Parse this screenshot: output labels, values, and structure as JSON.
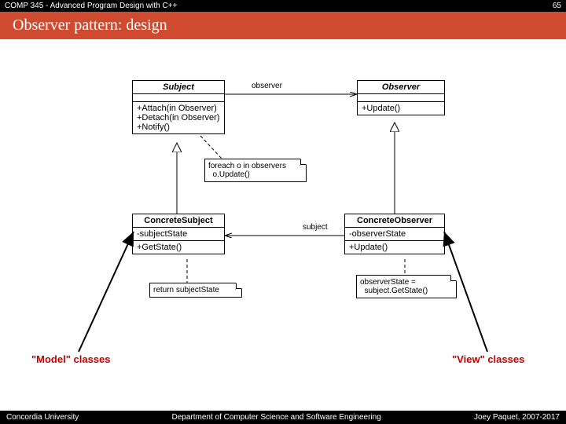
{
  "header": {
    "course": "COMP 345 - Advanced Program Design with C++",
    "slide_no": "65"
  },
  "title": "Observer pattern: design",
  "uml": {
    "subject": {
      "name": "Subject",
      "ops": [
        "+Attach(in Observer)",
        "+Detach(in Observer)",
        "+Notify()"
      ]
    },
    "observer": {
      "name": "Observer",
      "ops": [
        "+Update()"
      ]
    },
    "concrete_subject": {
      "name": "ConcreteSubject",
      "attrs": [
        "-subjectState"
      ],
      "ops": [
        "+GetState()"
      ]
    },
    "concrete_observer": {
      "name": "ConcreteObserver",
      "attrs": [
        "-observerState"
      ],
      "ops": [
        "+Update()"
      ]
    }
  },
  "assocs": {
    "observer_role": "observer",
    "subject_role": "subject"
  },
  "notes": {
    "notify": "foreach o in observers\n  o.Update()",
    "getstate": "return subjectState",
    "update": "observerState =\n  subject.GetState()"
  },
  "callouts": {
    "model": "\"Model\" classes",
    "view": "\"View\" classes"
  },
  "footer": {
    "left": "Concordia University",
    "center": "Department of Computer Science and Software Engineering",
    "right": "Joey Paquet, 2007-2017"
  }
}
